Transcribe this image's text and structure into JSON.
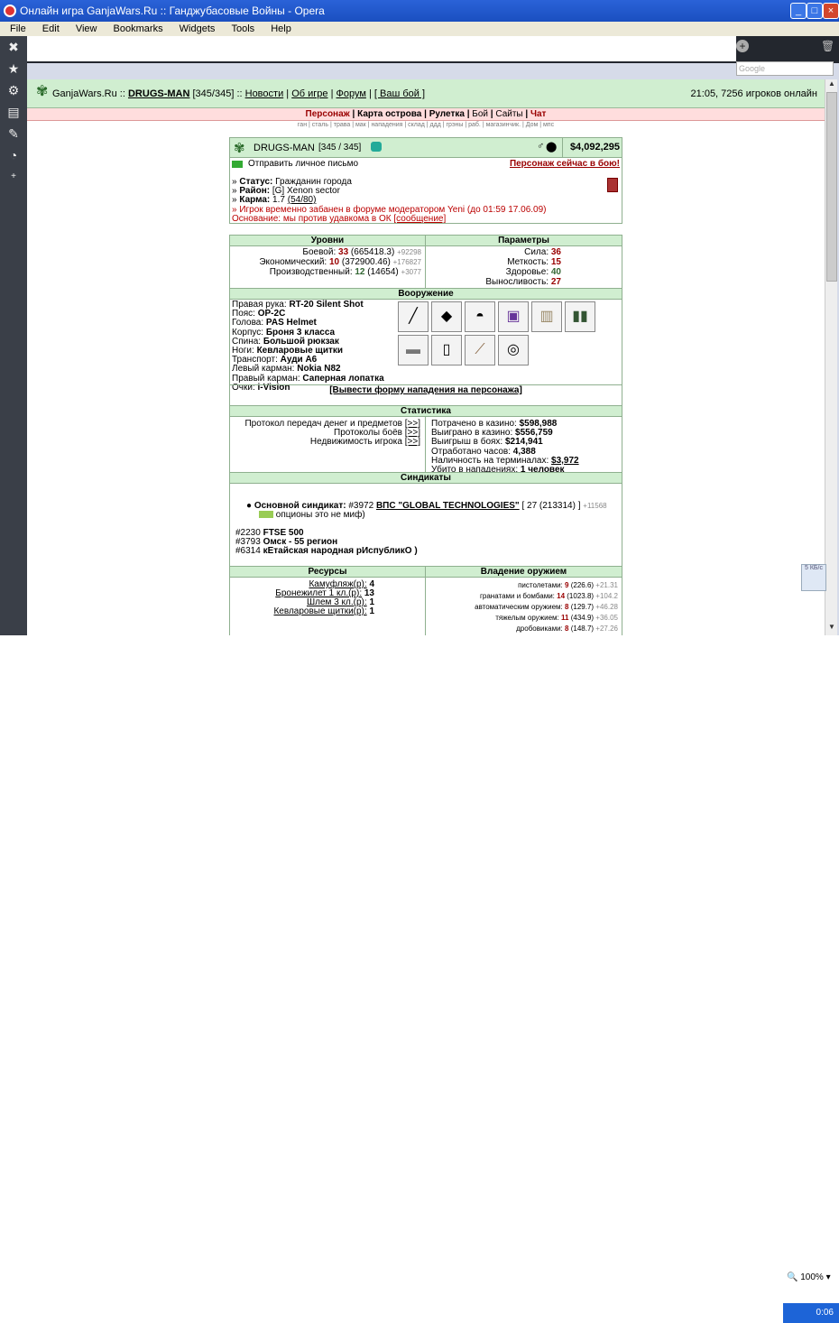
{
  "window": {
    "title": "Онлайн игра GanjaWars.Ru :: Ганджубасовые Войны - Opera"
  },
  "menu": [
    "File",
    "Edit",
    "View",
    "Bookmarks",
    "Widgets",
    "Tools",
    "Help"
  ],
  "search_placeholder": "Google",
  "header": {
    "site": "GanjaWars.Ru",
    "sep1": "::",
    "player": "DRUGS-MAN",
    "hp": "[345/345]",
    "sep2": "::",
    "news": "Новости",
    "about": "Об игре",
    "forum": "Форум",
    "fight": "[ Ваш бой ]",
    "clock": "21:05, 7256 игроков онлайн"
  },
  "nav": [
    "Персонаж",
    "Карта острова",
    "Рулетка",
    "Бой",
    "Сайты",
    "Чат"
  ],
  "subnav": "ган | сталь | трава | мак | нападения | склад | ддд | грэны | раб. | магазинчик. | Дом | мпс",
  "profile": {
    "name": "DRUGS-MAN",
    "hp": "[345 / 345]",
    "money": "$4,092,295",
    "send_msg": "Отправить личное письмо",
    "in_battle": "Персонаж сейчас в бою!",
    "status_label": "Статус:",
    "status_value": "Гражданин города",
    "district_label": "Район:",
    "district_value": "[G] Xenon sector",
    "karma_label": "Карма:",
    "karma_value": "1.7",
    "karma_detail": "(54/80)",
    "ban": "» Игрок временно забанен в форуме модератором Yeni (до 01:59 17.06.09)",
    "reason": "Основание: мы против удавкома в ОК",
    "reason_link": "[сообщение]"
  },
  "levels": {
    "title": "Уровни",
    "rows": [
      {
        "label": "Боевой:",
        "value": "33",
        "detail": "(665418.3)",
        "extra": "+92298"
      },
      {
        "label": "Экономический:",
        "value": "10",
        "detail": "(372900.46)",
        "extra": "+176827"
      },
      {
        "label": "Производственный:",
        "value": "12",
        "detail": "(14654)",
        "extra": "+3077"
      }
    ]
  },
  "params": {
    "title": "Параметры",
    "rows": [
      {
        "label": "Сила:",
        "value": "36"
      },
      {
        "label": "Меткость:",
        "value": "15"
      },
      {
        "label": "Здоровье:",
        "value": "40"
      },
      {
        "label": "Выносливость:",
        "value": "27"
      }
    ]
  },
  "weapons": {
    "title": "Вооружение",
    "rows": [
      {
        "label": "Правая рука:",
        "value": "RT-20 Silent Shot"
      },
      {
        "label": "Пояс:",
        "value": "OP-2C"
      },
      {
        "label": "Голова:",
        "value": "PAS Helmet"
      },
      {
        "label": "Корпус:",
        "value": "Броня 3 класса"
      },
      {
        "label": "Спина:",
        "value": "Большой рюкзак"
      },
      {
        "label": "Ноги:",
        "value": "Кевларовые щитки"
      },
      {
        "label": "Транспорт:",
        "value": "Ауди А6"
      },
      {
        "label": "Левый карман:",
        "value": "Nokia N82"
      },
      {
        "label": "Правый карман:",
        "value": "Саперная лопатка"
      },
      {
        "label": "Очки:",
        "value": "i-Vision"
      }
    ],
    "attack_form": "[Вывести форму нападения на персонажа]"
  },
  "stats": {
    "title": "Статистика",
    "left": [
      {
        "label": "Протокол передач денег и предметов",
        "link": "[>>]"
      },
      {
        "label": "Протоколы боёв",
        "link": "[>>]"
      },
      {
        "label": "Недвижимость игрока",
        "link": "[>>]"
      }
    ],
    "right": [
      {
        "label": "Потрачено в казино:",
        "value": "$598,988"
      },
      {
        "label": "Выиграно в казино:",
        "value": "$556,759"
      },
      {
        "label": "Выигрыш в боях:",
        "value": "$214,941"
      },
      {
        "label": "Отработано часов:",
        "value": "4,388"
      },
      {
        "label": "Наличность на терминалах:",
        "value": "$3,972"
      },
      {
        "label": "Убито в нападениях:",
        "value": "1 человек"
      }
    ]
  },
  "syndicates": {
    "title": "Синдикаты",
    "main_label": "Основной синдикат:",
    "main_id": "#3972",
    "main_name": "ВПС \"GLOBAL TECHNOLOGIES\"",
    "main_level": "[ 27 (213314) ]",
    "main_extra": "+11568",
    "main_note": "опционы это не миф)",
    "others": [
      {
        "id": "#2230",
        "name": "FTSE 500"
      },
      {
        "id": "#3793",
        "name": "Омск - 55 регион"
      },
      {
        "id": "#6314",
        "name": "кЕтайская народная рИспубликО )"
      }
    ]
  },
  "resources": {
    "title": "Ресурсы",
    "rows": [
      {
        "label": "Камуфляж(р):",
        "value": "4"
      },
      {
        "label": "Бронежилет 1 кл.(р):",
        "value": "13"
      },
      {
        "label": "Шлем 3 кл.(р):",
        "value": "1"
      },
      {
        "label": "Кевларовые щитки(р):",
        "value": "1"
      }
    ]
  },
  "weapon_mastery": {
    "title": "Владение оружием",
    "rows": [
      {
        "label": "пистолетами:",
        "value": "9",
        "detail": "(226.6)",
        "extra": "+21.31"
      },
      {
        "label": "гранатами и бомбами:",
        "value": "14",
        "detail": "(1023.8)",
        "extra": "+104.2"
      },
      {
        "label": "автоматическим оружием:",
        "value": "8",
        "detail": "(129.7)",
        "extra": "+46.28"
      },
      {
        "label": "тяжелым оружием:",
        "value": "11",
        "detail": "(434.9)",
        "extra": "+36.05"
      },
      {
        "label": "дробовиками:",
        "value": "8",
        "detail": "(148.7)",
        "extra": "+27.26"
      }
    ]
  },
  "status": {
    "zoom": "100%",
    "clock": "0:06",
    "speed": "5 КБ/с"
  }
}
